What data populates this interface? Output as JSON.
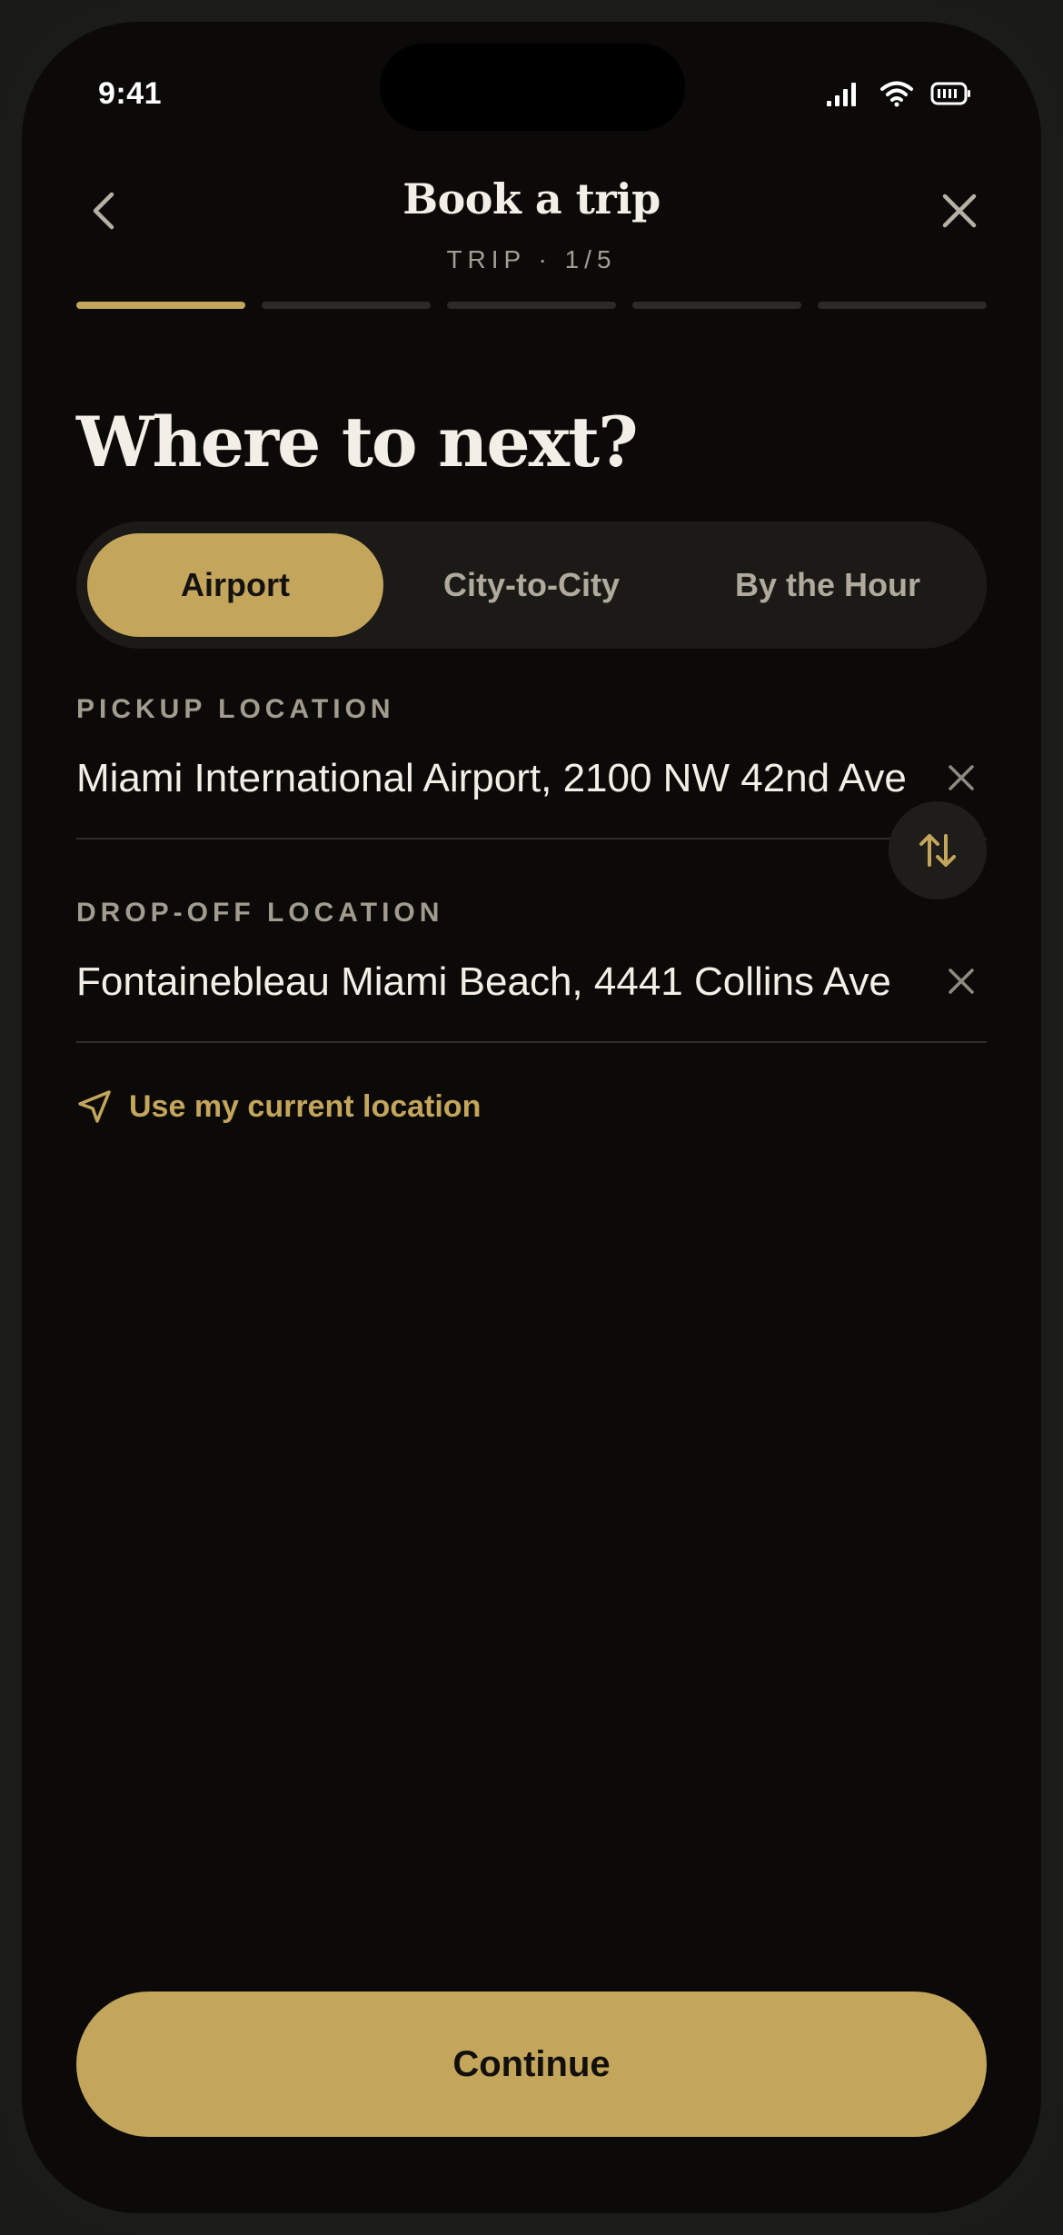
{
  "status": {
    "time": "9:41"
  },
  "header": {
    "title": "Book a trip",
    "step": "TRIP · 1/5"
  },
  "progress": {
    "total_steps": 5,
    "current_step": 1
  },
  "page": {
    "title": "Where to next?"
  },
  "trip_types": {
    "options": [
      "Airport",
      "City-to-City",
      "By the Hour"
    ],
    "selected": "Airport"
  },
  "pickup": {
    "label": "PICKUP LOCATION",
    "value": "Miami International Airport, 2100 NW 42nd Ave"
  },
  "dropoff": {
    "label": "DROP-OFF LOCATION",
    "value": "Fontainebleau Miami Beach, 4441 Collins Ave"
  },
  "current_location": {
    "label": "Use my current location"
  },
  "actions": {
    "continue_label": "Continue"
  },
  "colors": {
    "accent": "#c4a55c",
    "background": "#0b0a09",
    "text": "#f3efe6",
    "muted": "#a29c8f"
  }
}
